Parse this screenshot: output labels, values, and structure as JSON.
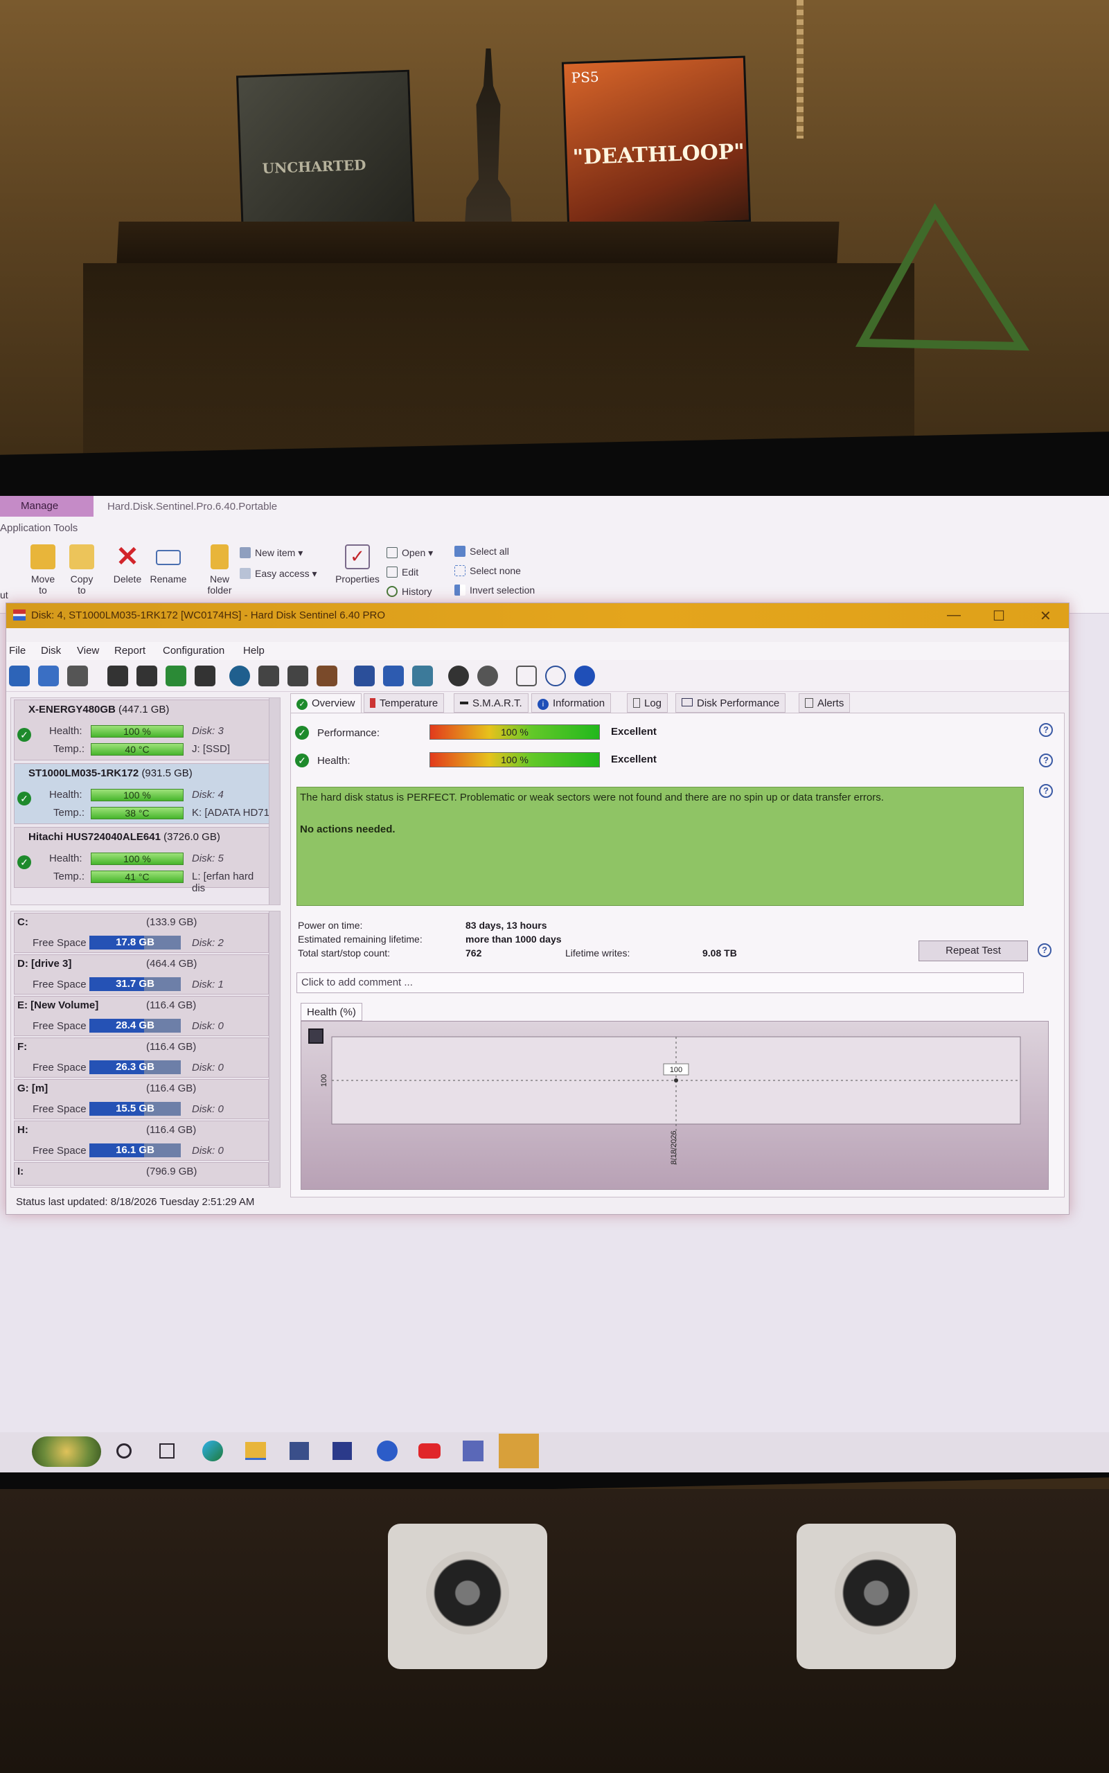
{
  "photo": {
    "game_case_brand": "PS5",
    "game_case_title": "\"DEATHLOOP\"",
    "other_case_title": "UNCHARTED"
  },
  "explorer": {
    "manage_tab": "Manage",
    "window_title": "Hard.Disk.Sentinel.Pro.6.40.Portable",
    "app_tools": "Application Tools",
    "cut_label": "ut",
    "buttons": {
      "move_to": "Move to",
      "copy_to": "Copy to",
      "delete": "Delete",
      "rename": "Rename",
      "new_folder": "New folder",
      "new_item": "New item",
      "easy_access": "Easy access",
      "properties": "Properties",
      "open": "Open",
      "edit": "Edit",
      "history": "History",
      "select_all": "Select all",
      "select_none": "Select none",
      "invert_selection": "Invert selection"
    }
  },
  "hds": {
    "title": "Disk: 4, ST1000LM035-1RK172 [WC0174HS]  -  Hard Disk Sentinel 6.40 PRO",
    "menu": [
      "File",
      "Disk",
      "View",
      "Report",
      "Configuration",
      "Help"
    ],
    "disks": [
      {
        "name": "X-ENERGY480GB",
        "capacity": "(447.1 GB)",
        "health_label": "Health:",
        "health": "100 %",
        "temp_label": "Temp.:",
        "temp": "40 °C",
        "disk": "Disk: 3",
        "drive": "J: [SSD]",
        "selected": false
      },
      {
        "name": "ST1000LM035-1RK172",
        "capacity": "(931.5 GB)",
        "health_label": "Health:",
        "health": "100 %",
        "temp_label": "Temp.:",
        "temp": "38 °C",
        "disk": "Disk: 4",
        "drive": "K: [ADATA HD71",
        "selected": true
      },
      {
        "name": "Hitachi HUS724040ALE641",
        "capacity": "(3726.0 GB)",
        "health_label": "Health:",
        "health": "100 %",
        "temp_label": "Temp.:",
        "temp": "41 °C",
        "disk": "Disk: 5",
        "drive": "L: [erfan hard dis",
        "selected": false
      }
    ],
    "free_space_label": "Free Space",
    "volumes": [
      {
        "name": "C:",
        "capacity": "(133.9 GB)",
        "free": "17.8 GB",
        "disk": "Disk: 2"
      },
      {
        "name": "D: [drive 3]",
        "capacity": "(464.4 GB)",
        "free": "31.7 GB",
        "disk": "Disk: 1"
      },
      {
        "name": "E: [New Volume]",
        "capacity": "(116.4 GB)",
        "free": "28.4 GB",
        "disk": "Disk: 0"
      },
      {
        "name": "F:",
        "capacity": "(116.4 GB)",
        "free": "26.3 GB",
        "disk": "Disk: 0"
      },
      {
        "name": "G: [m]",
        "capacity": "(116.4 GB)",
        "free": "15.5 GB",
        "disk": "Disk: 0"
      },
      {
        "name": "H:",
        "capacity": "(116.4 GB)",
        "free": "16.1 GB",
        "disk": "Disk: 0"
      },
      {
        "name": "I:",
        "capacity": "(796.9 GB)",
        "free": "",
        "disk": ""
      }
    ],
    "status_bar": "Status last updated: 8/18/2026 Tuesday 2:51:29 AM",
    "tabs": [
      "Overview",
      "Temperature",
      "S.M.A.R.T.",
      "Information",
      "Log",
      "Disk Performance",
      "Alerts"
    ],
    "performance": {
      "label": "Performance:",
      "value": "100 %",
      "rating": "Excellent"
    },
    "health": {
      "label": "Health:",
      "value": "100 %",
      "rating": "Excellent"
    },
    "status_message": "The hard disk status is PERFECT. Problematic or weak sectors were not found and there are no spin up or data transfer errors.",
    "status_action": "No actions needed.",
    "info": {
      "power_on_label": "Power on time:",
      "power_on_value": "83 days, 13 hours",
      "lifetime_label": "Estimated remaining lifetime:",
      "lifetime_value": "more than 1000 days",
      "startstop_label": "Total start/stop count:",
      "startstop_value": "762",
      "writes_label": "Lifetime writes:",
      "writes_value": "9.08 TB"
    },
    "repeat_test": "Repeat Test",
    "comment_placeholder": "Click to add comment ...",
    "health_chart_tab": "Health (%)"
  },
  "chart_data": {
    "type": "line",
    "title": "",
    "x": [
      "8/18/2026"
    ],
    "series": [
      {
        "values": [
          100
        ]
      }
    ],
    "ylabel": "",
    "xlabel": "",
    "y_tick_labels": [
      "100"
    ],
    "data_labels": [
      "100"
    ]
  },
  "taskbar": {
    "icons": [
      "start-icon",
      "cortana-icon",
      "task-view-icon",
      "edge-icon",
      "file-explorer-icon",
      "app-icon",
      "powershell-icon",
      "facebook-icon",
      "youtube-icon",
      "chat-icon",
      "hard-disk-sentinel-icon"
    ]
  }
}
